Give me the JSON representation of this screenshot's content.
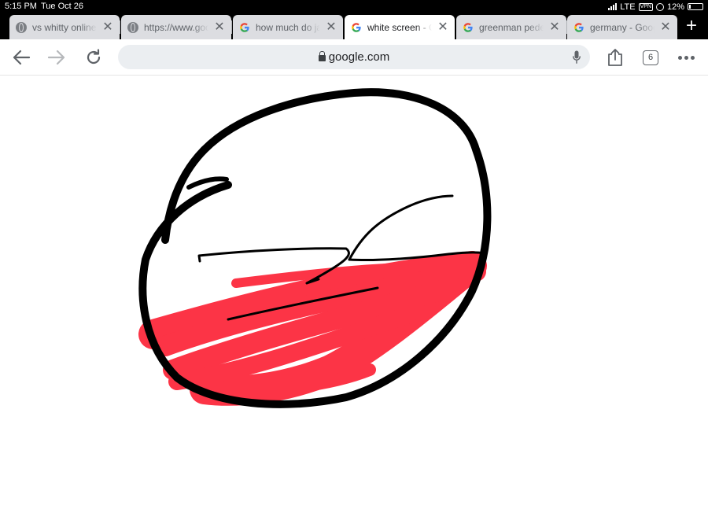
{
  "status_bar": {
    "time": "5:15 PM",
    "date": "Tue Oct 26",
    "network": "LTE",
    "vpn": "VPN",
    "battery": "12%",
    "battery_level": 0.12
  },
  "tabs": [
    {
      "title": "vs whitty online",
      "favicon": "globe-icon",
      "active": false
    },
    {
      "title": "https://www.google",
      "favicon": "globe-icon",
      "active": false
    },
    {
      "title": "how much do java",
      "favicon": "google-g-icon",
      "active": false
    },
    {
      "title": "white screen - Goo",
      "favicon": "google-g-icon",
      "active": true
    },
    {
      "title": "greenman pedes",
      "favicon": "google-g-icon",
      "active": false
    },
    {
      "title": "germany - Google",
      "favicon": "google-g-icon",
      "active": false
    }
  ],
  "new_tab_label": "+",
  "tab_close_glyph": "✕",
  "toolbar": {
    "url": "google.com",
    "tab_count": "6"
  },
  "colors": {
    "ink": "#000000",
    "scribble": "#fc3446",
    "tab_active": "#ffffff",
    "tab_inactive": "#dcdde1"
  }
}
